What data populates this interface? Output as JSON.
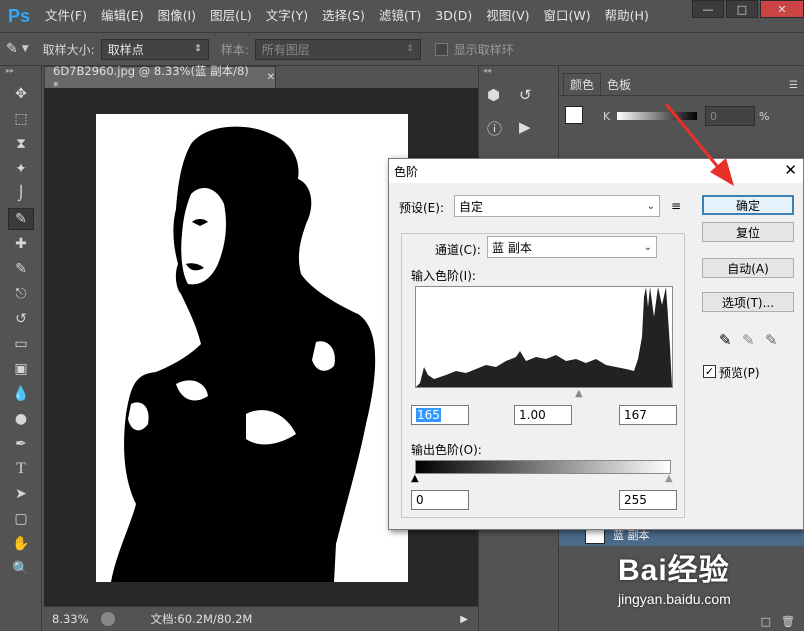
{
  "app": {
    "logo": "Ps",
    "menu": [
      {
        "label": "文件(F)"
      },
      {
        "label": "编辑(E)"
      },
      {
        "label": "图像(I)"
      },
      {
        "label": "图层(L)"
      },
      {
        "label": "文字(Y)"
      },
      {
        "label": "选择(S)"
      },
      {
        "label": "滤镜(T)"
      },
      {
        "label": "3D(D)"
      },
      {
        "label": "视图(V)"
      },
      {
        "label": "窗口(W)"
      },
      {
        "label": "帮助(H)"
      }
    ]
  },
  "options_bar": {
    "sample_size_label": "取样大小:",
    "sample_size_value": "取样点",
    "sample_label": "样本:",
    "sample_value": "所有图层",
    "show_ring_label": "显示取样环"
  },
  "document": {
    "tab_title": "6D7B2960.jpg @ 8.33%(蓝 副本/8) *",
    "zoom": "8.33%",
    "doc_size": "文档:60.2M/80.2M"
  },
  "right_panel": {
    "tabs": [
      {
        "label": "颜色"
      },
      {
        "label": "色板"
      }
    ],
    "k_label": "K",
    "k_value": "0",
    "percent": "%",
    "layer_name": "蓝 副本"
  },
  "dialog": {
    "title": "色阶",
    "preset_label": "预设(E):",
    "preset_value": "自定",
    "channel_label": "通道(C):",
    "channel_value": "蓝 副本",
    "input_levels_label": "输入色阶(I):",
    "input_black": "165",
    "input_gamma": "1.00",
    "input_white": "167",
    "output_levels_label": "输出色阶(O):",
    "output_black": "0",
    "output_white": "255",
    "buttons": {
      "ok": "确定",
      "reset": "复位",
      "auto": "自动(A)",
      "options": "选项(T)..."
    },
    "preview_label": "预览(P)",
    "preview_checked": true
  },
  "watermark": {
    "brand": "Bai经验",
    "url": "jingyan.baidu.com"
  },
  "colors": {
    "accent": "#31a8ff",
    "arrow": "#e8302a",
    "dialog_bg": "#f0f0f0"
  }
}
